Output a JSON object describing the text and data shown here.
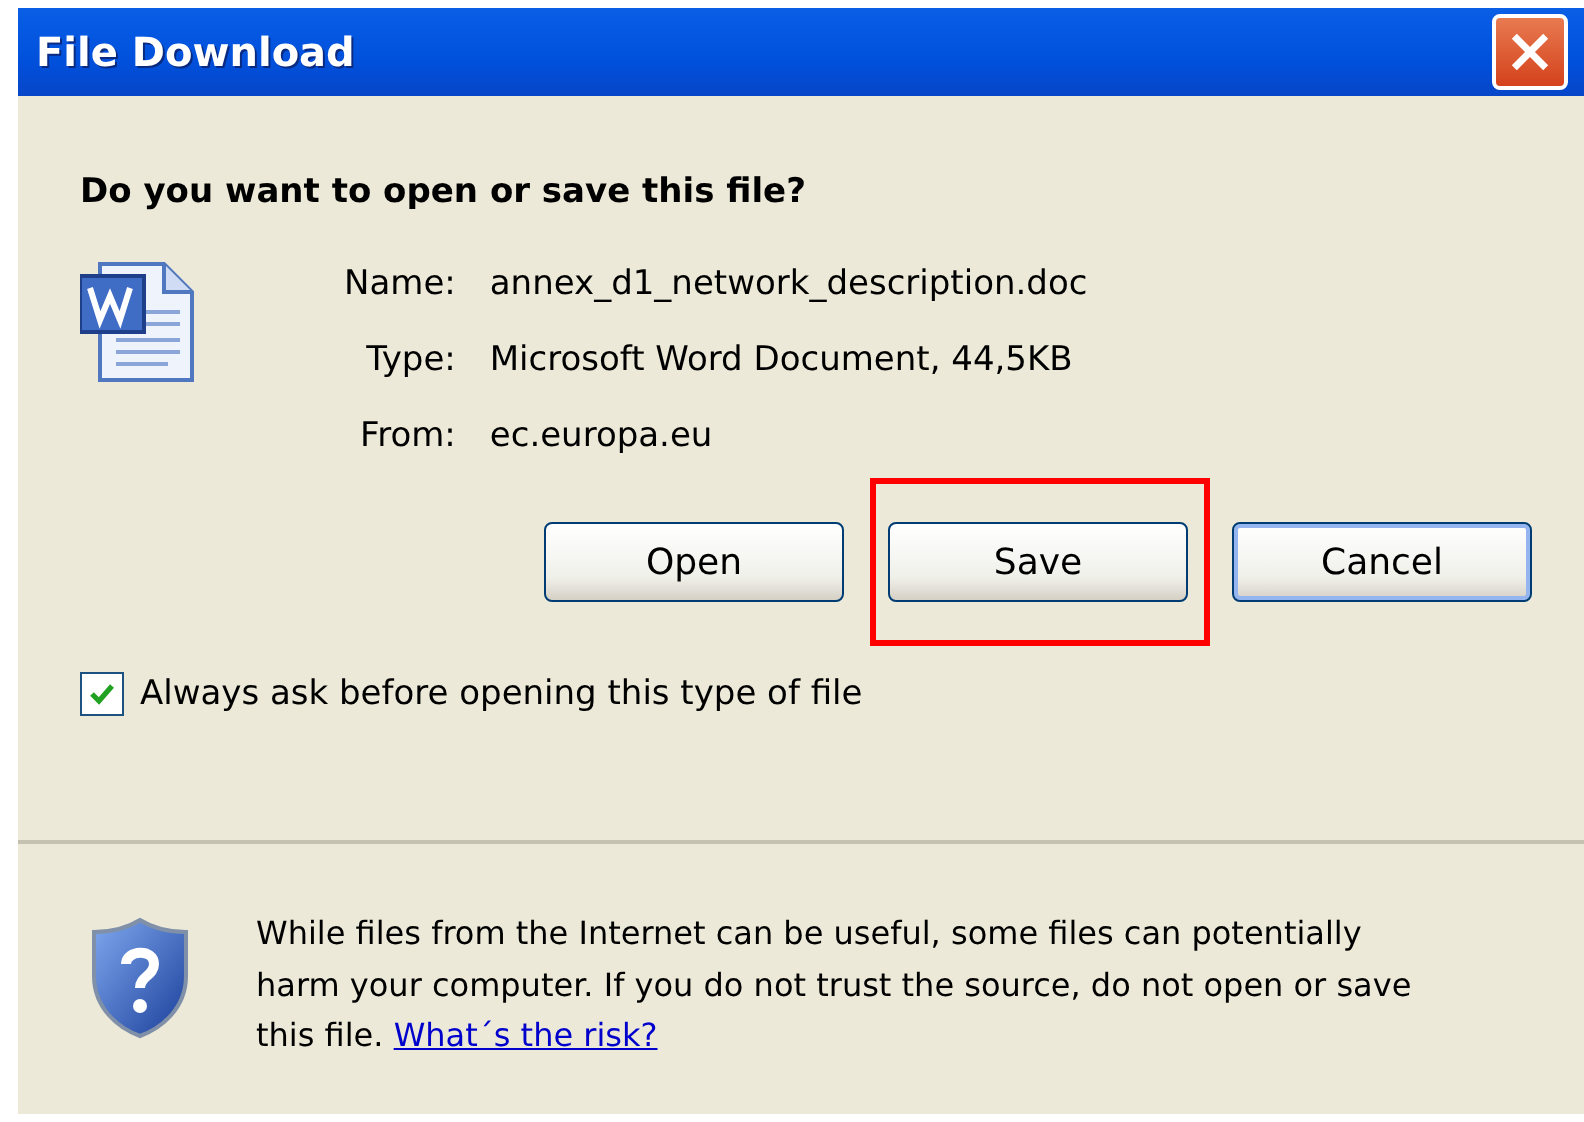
{
  "window": {
    "title": "File Download"
  },
  "question": "Do you want to open or save this file?",
  "details": [
    {
      "label": "Name:",
      "value": "annex_d1_network_description.doc"
    },
    {
      "label": "Type:",
      "value": "Microsoft Word Document, 44,5KB"
    },
    {
      "label": "From:",
      "value": "ec.europa.eu"
    }
  ],
  "buttons": [
    {
      "label": "Open",
      "default": false,
      "highlighted": false
    },
    {
      "label": "Save",
      "default": false,
      "highlighted": true
    },
    {
      "label": "Cancel",
      "default": true,
      "highlighted": false
    }
  ],
  "always_ask": {
    "label": "Always ask before opening this type of file",
    "checked": true
  },
  "warning": {
    "text": "While files from the Internet can be useful, some files can potentially harm your computer. If you do not trust the source, do not open or save this file. ",
    "link": "What´s the risk?"
  }
}
